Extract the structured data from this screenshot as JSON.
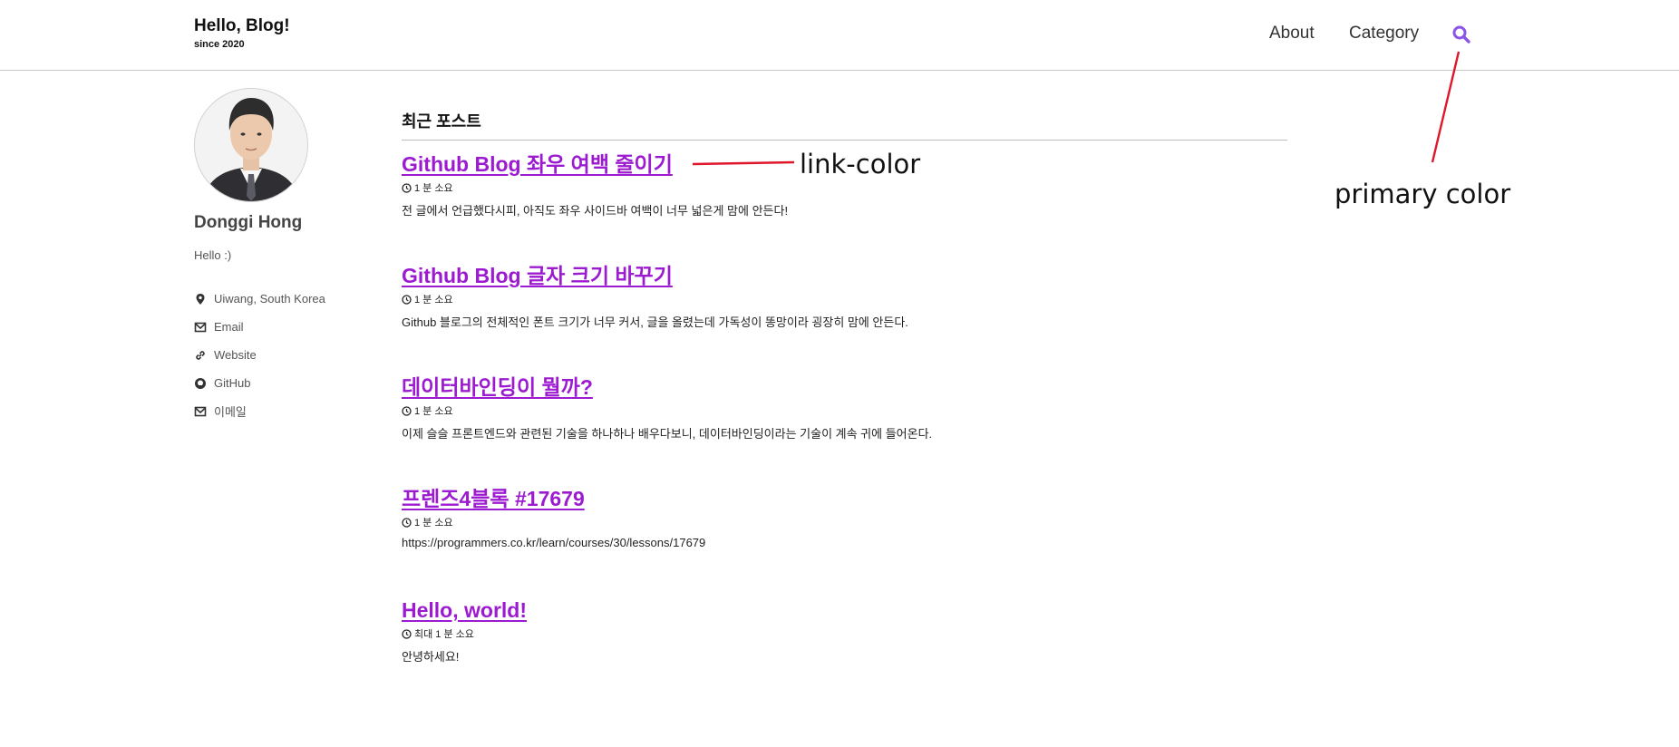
{
  "header": {
    "title": "Hello, Blog!",
    "subtitle": "since 2020",
    "nav": [
      {
        "label": "About"
      },
      {
        "label": "Category"
      }
    ],
    "search_icon": "search-icon",
    "primary_color": "#8b55e8"
  },
  "author": {
    "name": "Donggi Hong",
    "bio": "Hello :)",
    "links": [
      {
        "icon": "map-marker-icon",
        "label": "Uiwang, South Korea"
      },
      {
        "icon": "envelope-icon",
        "label": "Email"
      },
      {
        "icon": "link-icon",
        "label": "Website"
      },
      {
        "icon": "github-icon",
        "label": "GitHub"
      },
      {
        "icon": "envelope-icon",
        "label": "이메일"
      }
    ]
  },
  "main": {
    "section_title": "최근 포스트",
    "link_color": "#9c1bd1",
    "posts": [
      {
        "title": "Github Blog 좌우 여백 줄이기",
        "read_time": "1 분 소요",
        "excerpt": "전 글에서 언급했다시피, 아직도 좌우 사이드바 여백이 너무 넓은게 맘에 안든다!"
      },
      {
        "title": "Github Blog 글자 크기 바꾸기",
        "read_time": "1 분 소요",
        "excerpt": "Github 블로그의 전체적인 폰트 크기가 너무 커서, 글을 올렸는데 가독성이 똥망이라 굉장히 맘에 안든다."
      },
      {
        "title": "데이터바인딩이 뭘까?",
        "read_time": "1 분 소요",
        "excerpt": "이제 슬슬 프론트엔드와 관련된 기술을 하나하나 배우다보니, 데이터바인딩이라는 기술이 계속 귀에 들어온다."
      },
      {
        "title": "프렌즈4블록 #17679",
        "read_time": "1 분 소요",
        "excerpt": "https://programmers.co.kr/learn/courses/30/lessons/17679"
      },
      {
        "title": "Hello, world!",
        "read_time": "최대 1 분 소요",
        "excerpt": "안녕하세요!"
      }
    ]
  },
  "annotations": {
    "link_color_label": "link-color",
    "primary_color_label": "primary color",
    "line_color": "#e0162b"
  }
}
